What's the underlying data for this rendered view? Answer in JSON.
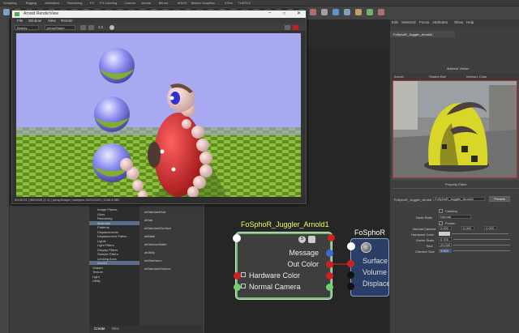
{
  "shelf": {
    "tabs": [
      "Sculpting",
      "Rigging",
      "Animation",
      "Rendering",
      "FX",
      "FX Caching",
      "Custom",
      "Arnold",
      "Bifrost",
      "MASH",
      "Motion Graphics",
      "XGen",
      "TURTLE"
    ]
  },
  "render_view": {
    "title": "Arnold RenderView",
    "menu": [
      "File",
      "Window",
      "View",
      "Render"
    ],
    "camera": "Beauty",
    "camera_shape": "perspShape",
    "zoom": "1:1",
    "status": "00:00:01 | 960x540 (1:1) | perspShape | samples 3/2/2/2/2/0 | 1146.8 MB"
  },
  "outliner": {
    "tree": [
      "Image Planes",
      "Glow",
      "Rendering",
      "Materials",
      "Patterns",
      "Displacements",
      "Displacement Patter...",
      "Lights",
      "Light Filters",
      "Display Filters",
      "Sample Filters",
      "Lensing Aovs",
      "Arnold",
      "Shader",
      "Texture",
      "Light",
      "Utility"
    ],
    "nodes": [
      "aiStandardHair",
      "aiHair",
      "aiStandardSurface",
      "aiMatte",
      "aiShadowMatte",
      "aiUtility",
      "aiWireframe",
      "aiStandardVolume"
    ],
    "bottom_tabs": [
      "Create",
      "Bins"
    ]
  },
  "right_panel": {
    "menu": [
      "Edit",
      "Selected",
      "Focus",
      "Attributes",
      "Show",
      "Help"
    ],
    "node_tab": "FoSphoR_Juggler_Arnold1"
  },
  "material_viewer": {
    "title": "Material Viewer",
    "renderer": "Arnold",
    "shape": "Shader Ball",
    "env": "Interior1 Color"
  },
  "property_editor": {
    "title": "Property Editor",
    "node_label": "FoSphoR_Juggler_Arnold",
    "node_value": "FoSphoR_Juggler_Arnold1",
    "presets": "Presets",
    "caching": "Caching",
    "node_state_label": "Node State",
    "node_state": "Normal",
    "frozen": "Frozen",
    "normal_camera_label": "Normal Camera",
    "normal_camera": [
      "0.000",
      "0.000",
      "0.000"
    ],
    "hardware_color_label": "Hardware Color",
    "scene_scale_label": "Scene Scale",
    "scene_scale": "0.700",
    "time_label": "Time",
    "time": "20.000",
    "checker_label": "Checker Size",
    "checker": "3.500"
  },
  "node_editor": {
    "node1": {
      "title": "FoSphoR_Juggler_Arnold1",
      "rows": [
        "Message",
        "Out Color",
        "Hardware Color",
        "Normal Camera"
      ]
    },
    "node2": {
      "title": "FoSphoR",
      "rows": [
        "Surface",
        "Volume",
        "Displace"
      ]
    }
  },
  "colors": {
    "title_yellow": "#e9ff5f",
    "node_border": "#70c070",
    "port_red": "#d02020",
    "port_green": "#70d070",
    "sky": "#a9a9f2",
    "ground": "#7aa832"
  }
}
